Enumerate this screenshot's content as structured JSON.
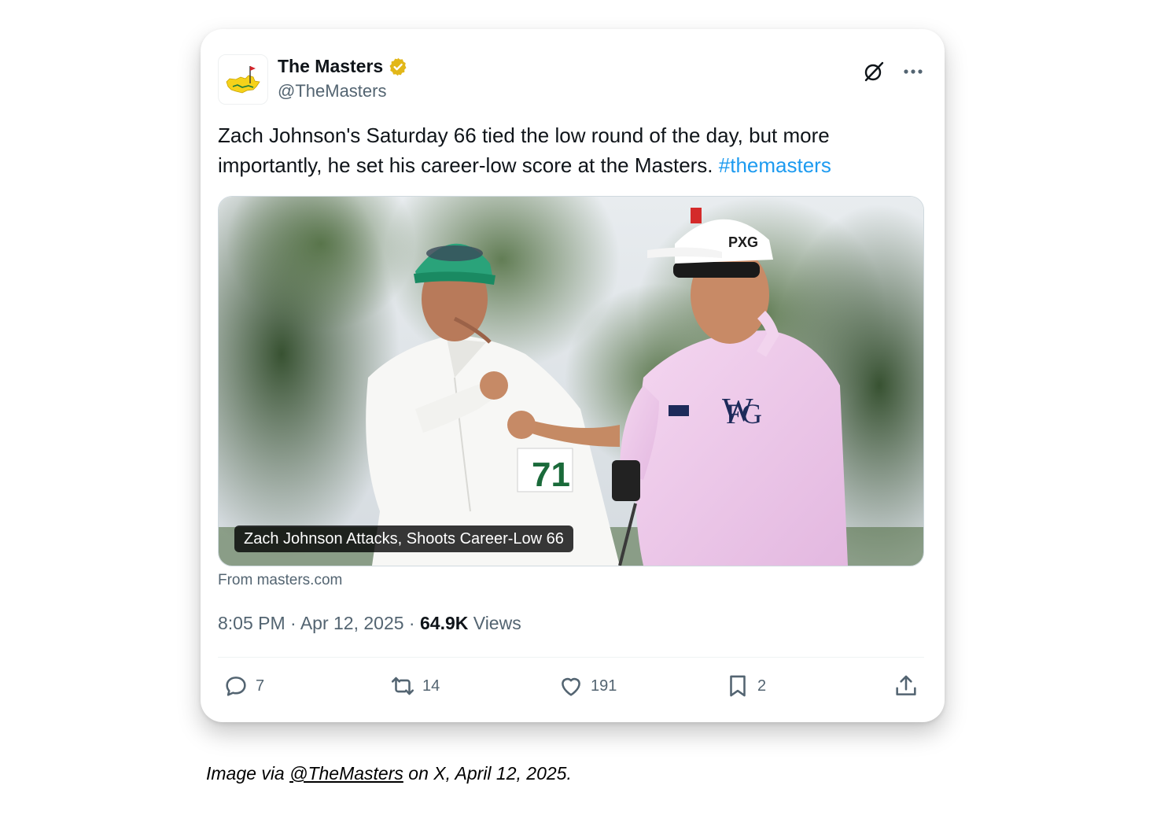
{
  "tweet": {
    "author": {
      "name": "The Masters",
      "handle": "@TheMasters",
      "verified_badge_color": "#e2b719"
    },
    "text_main": "Zach Johnson's Saturday 66 tied the low round of the day, but more importantly, he set his career-low score at the Masters. ",
    "hashtag": "#themasters",
    "media": {
      "caption": "Zach Johnson Attacks, Shoots Career-Low 66",
      "source": "From masters.com"
    },
    "meta": {
      "time": "8:05 PM",
      "separator": " · ",
      "date": "Apr 12, 2025",
      "views_count": "64.9K",
      "views_label": "Views"
    },
    "actions": {
      "replies": "7",
      "reposts": "14",
      "likes": "191",
      "bookmarks": "2"
    },
    "icons": {
      "grok": "grok-icon",
      "more": "more-icon",
      "reply": "reply-icon",
      "repost": "repost-icon",
      "like": "heart-icon",
      "bookmark": "bookmark-icon",
      "share": "share-icon"
    },
    "colors": {
      "text": "#0f1419",
      "secondary": "#536471",
      "link": "#1d9bf0"
    }
  },
  "footer": {
    "prefix": "Image via ",
    "link": "@TheMasters",
    "suffix": " on X, April 12, 2025."
  }
}
